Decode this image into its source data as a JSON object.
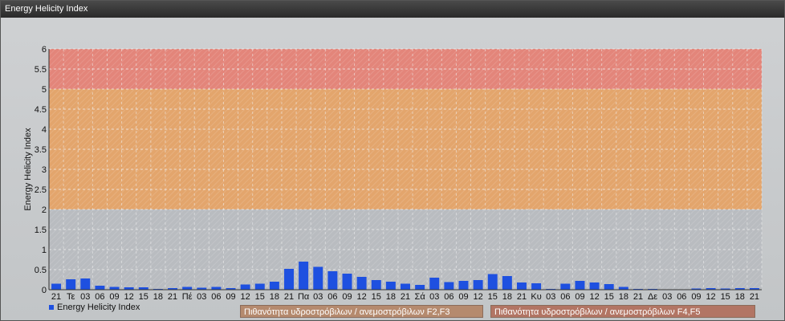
{
  "window": {
    "title": "Energy Helicity Index"
  },
  "legend": {
    "series": "Energy Helicity Index",
    "band_f23": "Πιθανότητα υδροστρόβιλων / ανεμοστρόβιλων F2,F3",
    "band_f45": "Πιθανότητα υδροστρόβιλων / ανεμοστρόβιλων F4,F5"
  },
  "colors": {
    "bar": "#1e50e0",
    "band_low": "#b9bcc0",
    "band_mid": "#e3a56c",
    "band_high": "#e3857a",
    "grid": "#f0f0f0"
  },
  "chart_data": {
    "type": "bar",
    "ylabel": "Energy Helicity Index",
    "ylim": [
      0,
      6
    ],
    "yticks": [
      "0",
      "0.5",
      "1",
      "1.5",
      "2",
      "2.5",
      "3",
      "3.5",
      "4",
      "4.5",
      "5",
      "5.5",
      "6"
    ],
    "bands": [
      {
        "from": 0,
        "to": 2,
        "color": "#b9bcc0"
      },
      {
        "from": 2,
        "to": 5,
        "color": "#e3a56c"
      },
      {
        "from": 5,
        "to": 6,
        "color": "#e3857a"
      }
    ],
    "categories": [
      "21",
      "Τε",
      "03",
      "06",
      "09",
      "12",
      "15",
      "18",
      "21",
      "Πέ",
      "03",
      "06",
      "09",
      "12",
      "15",
      "18",
      "21",
      "Πα",
      "03",
      "06",
      "09",
      "12",
      "15",
      "18",
      "21",
      "Σά",
      "03",
      "06",
      "09",
      "12",
      "15",
      "18",
      "21",
      "Κυ",
      "03",
      "06",
      "09",
      "12",
      "15",
      "18",
      "21",
      "Δε",
      "03",
      "06",
      "09",
      "12",
      "15",
      "18",
      "21"
    ],
    "values": [
      0.15,
      0.26,
      0.28,
      0.1,
      0.07,
      0.06,
      0.06,
      0.02,
      0.04,
      0.07,
      0.05,
      0.07,
      0.04,
      0.13,
      0.15,
      0.2,
      0.52,
      0.7,
      0.57,
      0.46,
      0.4,
      0.32,
      0.24,
      0.2,
      0.15,
      0.12,
      0.3,
      0.19,
      0.22,
      0.24,
      0.39,
      0.34,
      0.18,
      0.16,
      0.02,
      0.15,
      0.22,
      0.18,
      0.14,
      0.07,
      0.02,
      0.02,
      0.01,
      0.01,
      0.03,
      0.04,
      0.03,
      0.04,
      0.04
    ]
  }
}
